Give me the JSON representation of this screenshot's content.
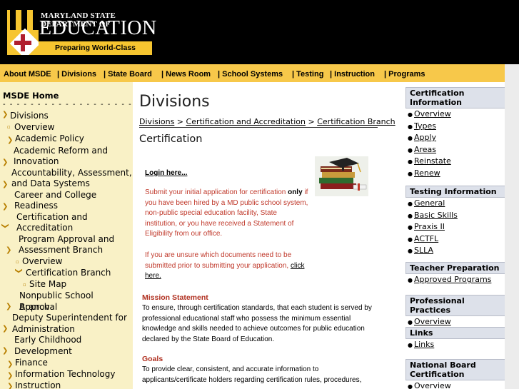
{
  "header": {
    "logo_top": "MARYLAND STATE DEPARTMENT OF",
    "logo_main": "EDUCATION",
    "tagline": "Preparing World-Class Students",
    "accent_color": "#f6c530"
  },
  "topnav": {
    "items": [
      "About MSDE",
      "| Divisions",
      "| State Board",
      "| News Room",
      "| School Systems",
      "| Testing",
      "| Instruction",
      "| Programs"
    ]
  },
  "sidebar": {
    "home": "MSDE Home",
    "dashes": "- - - - - - - - - - - - - - - - - - - - -",
    "items": [
      "Divisions",
      "Overview",
      "Academic Policy",
      "Academic Reform and",
      "Innovation",
      "Accountability, Assessment,",
      "and Data Systems",
      "Career and College",
      "Readiness",
      "Certification and",
      "Accreditation",
      "Program Approval and",
      "Assessment Branch",
      "Overview",
      "Certification Branch",
      "Site Map",
      "Nonpublic School Approval",
      "Branch",
      "Deputy Superintendent for",
      "Administration",
      "Early Childhood",
      "Development",
      "Finance",
      "Information Technology",
      "Instruction"
    ]
  },
  "main": {
    "title": "Divisions",
    "breadcrumb": [
      "Divisions",
      "Certification and Accreditation",
      "Certification Branch"
    ],
    "breadcrumb_sep": " > ",
    "section_title": "Certification",
    "login": "Login here...",
    "para1_a": "Submit your initial application for certification ",
    "para1_bold": "only",
    "para1_b": " if you have been hired by a MD public school system, non-public special education facility, State institution, or you have received a Statement of Eligibility from our office.",
    "para2_a": "If you are unsure which documents need to be submitted prior to submitting your application, ",
    "para2_link": "click here.",
    "mission_head": "Mission Statement",
    "mission_text": "To ensure, through certification standards, that each student is served by professional educational staff who possess the minimum essential knowledge and skills needed to achieve outcomes for public education declared by the State Board of Education.",
    "goals_head": "Goals",
    "goals_text": "To provide clear, consistent, and accurate information to applicants/certificate holders regarding certification rules, procedures,"
  },
  "rightbar": {
    "boxes": [
      {
        "title": "Certification Information",
        "links": [
          "Overview",
          "Types",
          "Apply",
          "Areas",
          "Reinstate",
          "Renew"
        ]
      },
      {
        "title": "Testing Information",
        "links": [
          "General",
          "Basic Skills",
          "Praxis II",
          "ACTFL",
          "SLLA"
        ]
      },
      {
        "title": "Teacher Preparation",
        "links": [
          "Approved Programs"
        ]
      },
      {
        "title": "Professional Practices",
        "links": [
          "Overview"
        ]
      },
      {
        "title": "Links",
        "links": [
          "Links"
        ]
      },
      {
        "title": "National Board Certification",
        "links": [
          "Overview"
        ]
      }
    ]
  }
}
